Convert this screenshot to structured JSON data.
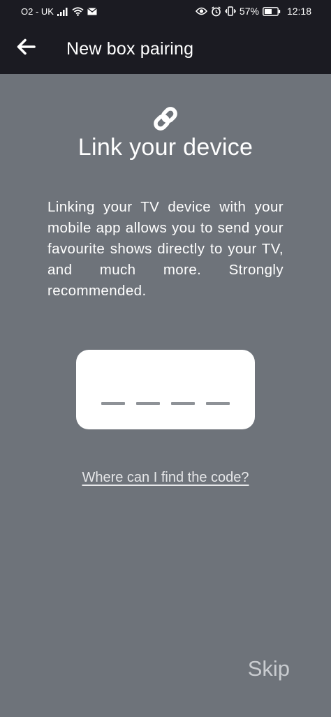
{
  "status_bar": {
    "carrier": "O2 - UK",
    "battery": "57%",
    "time": "12:18"
  },
  "app_bar": {
    "title": "New box pairing",
    "back_icon": "arrow-left-icon"
  },
  "main": {
    "icon": "link-icon",
    "heading": "Link your device",
    "description": "Linking your TV device with your mobile app allows you to send your favourite shows directly to your TV, and much more. Strongly recommended.",
    "code_input": {
      "slots": 4,
      "value": ""
    },
    "help_link": "Where can I find the code?",
    "skip_label": "Skip"
  },
  "colors": {
    "header_bg": "#1b1b22",
    "page_bg": "#6e737a",
    "text": "#ffffff",
    "skip_text": "#c9ccd0"
  }
}
